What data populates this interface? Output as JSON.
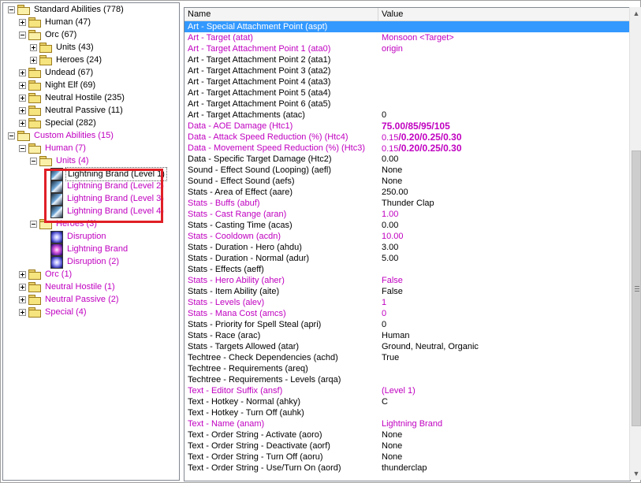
{
  "tree": [
    {
      "label": "Standard Abilities (778)",
      "indent": 0,
      "exp": "minus",
      "icon": "folder-open",
      "magenta": false
    },
    {
      "label": "Human (47)",
      "indent": 1,
      "exp": "plus",
      "icon": "folder",
      "magenta": false
    },
    {
      "label": "Orc (67)",
      "indent": 1,
      "exp": "minus",
      "icon": "folder-open",
      "magenta": false
    },
    {
      "label": "Units (43)",
      "indent": 2,
      "exp": "plus",
      "icon": "folder",
      "magenta": false
    },
    {
      "label": "Heroes (24)",
      "indent": 2,
      "exp": "plus",
      "icon": "folder",
      "magenta": false
    },
    {
      "label": "Undead (67)",
      "indent": 1,
      "exp": "plus",
      "icon": "folder",
      "magenta": false
    },
    {
      "label": "Night Elf (69)",
      "indent": 1,
      "exp": "plus",
      "icon": "folder",
      "magenta": false
    },
    {
      "label": "Neutral Hostile (235)",
      "indent": 1,
      "exp": "plus",
      "icon": "folder",
      "magenta": false
    },
    {
      "label": "Neutral Passive (11)",
      "indent": 1,
      "exp": "plus",
      "icon": "folder",
      "magenta": false
    },
    {
      "label": "Special (282)",
      "indent": 1,
      "exp": "plus",
      "icon": "folder",
      "magenta": false
    },
    {
      "label": "Custom Abilities (15)",
      "indent": 0,
      "exp": "minus",
      "icon": "folder-open",
      "magenta": true
    },
    {
      "label": "Human (7)",
      "indent": 1,
      "exp": "minus",
      "icon": "folder-open",
      "magenta": true
    },
    {
      "label": "Units (4)",
      "indent": 2,
      "exp": "minus",
      "icon": "folder-open",
      "magenta": true
    },
    {
      "label": "Lightning Brand (Level 1)",
      "indent": 3,
      "exp": "",
      "icon": "lb",
      "magenta": false,
      "selected": true
    },
    {
      "label": "Lightning Brand (Level 2)",
      "indent": 3,
      "exp": "",
      "icon": "lb",
      "magenta": true
    },
    {
      "label": "Lightning Brand (Level 3)",
      "indent": 3,
      "exp": "",
      "icon": "lb",
      "magenta": true
    },
    {
      "label": "Lightning Brand (Level 4)",
      "indent": 3,
      "exp": "",
      "icon": "lb",
      "magenta": true
    },
    {
      "label": "Heroes (3)",
      "indent": 2,
      "exp": "minus",
      "icon": "folder-open",
      "magenta": true
    },
    {
      "label": "Disruption",
      "indent": 3,
      "exp": "",
      "icon": "dis",
      "magenta": true
    },
    {
      "label": "Lightning Brand",
      "indent": 3,
      "exp": "",
      "icon": "lbh",
      "magenta": true
    },
    {
      "label": "Disruption (2)",
      "indent": 3,
      "exp": "",
      "icon": "dis",
      "magenta": true
    },
    {
      "label": "Orc (1)",
      "indent": 1,
      "exp": "plus",
      "icon": "folder",
      "magenta": true
    },
    {
      "label": "Neutral Hostile (1)",
      "indent": 1,
      "exp": "plus",
      "icon": "folder",
      "magenta": true
    },
    {
      "label": "Neutral Passive (2)",
      "indent": 1,
      "exp": "plus",
      "icon": "folder",
      "magenta": true
    },
    {
      "label": "Special (4)",
      "indent": 1,
      "exp": "plus",
      "icon": "folder",
      "magenta": true
    }
  ],
  "grid": {
    "col_name": "Name",
    "col_value": "Value",
    "rows": [
      {
        "name": "Art - Special Attachment Point (aspt)",
        "value": "",
        "magenta": false,
        "selected": true
      },
      {
        "name": "Art - Target (atat)",
        "value": "Monsoon <Target>",
        "magenta": true
      },
      {
        "name": "Art - Target Attachment Point 1 (ata0)",
        "value": "origin",
        "magenta": true
      },
      {
        "name": "Art - Target Attachment Point 2 (ata1)",
        "value": "",
        "magenta": false
      },
      {
        "name": "Art - Target Attachment Point 3 (ata2)",
        "value": "",
        "magenta": false
      },
      {
        "name": "Art - Target Attachment Point 4 (ata3)",
        "value": "",
        "magenta": false
      },
      {
        "name": "Art - Target Attachment Point 5 (ata4)",
        "value": "",
        "magenta": false
      },
      {
        "name": "Art - Target Attachment Point 6 (ata5)",
        "value": "",
        "magenta": false
      },
      {
        "name": "Art - Target Attachments (atac)",
        "value": "0",
        "magenta": false
      },
      {
        "name": "Data - AOE Damage (Htc1)",
        "value": "75.00/85/95/105",
        "magenta": true,
        "big": true
      },
      {
        "name": "Data - Attack Speed Reduction (%) (Htc4)",
        "value": "0.15",
        "extra": "/0.20/0.25/0.30",
        "magenta": true
      },
      {
        "name": "Data - Movement Speed Reduction (%) (Htc3)",
        "value": "0.15",
        "extra": "/0.20/0.25/0.30",
        "magenta": true
      },
      {
        "name": "Data - Specific Target Damage (Htc2)",
        "value": "0.00",
        "magenta": false
      },
      {
        "name": "Sound - Effect Sound (Looping) (aefl)",
        "value": "None",
        "magenta": false
      },
      {
        "name": "Sound - Effect Sound (aefs)",
        "value": "None",
        "magenta": false
      },
      {
        "name": "Stats - Area of Effect (aare)",
        "value": "250.00",
        "magenta": false
      },
      {
        "name": "Stats - Buffs (abuf)",
        "value": "Thunder Clap",
        "magenta": true,
        "value_black": true
      },
      {
        "name": "Stats - Cast Range (aran)",
        "value": "1.00",
        "magenta": true
      },
      {
        "name": "Stats - Casting Time (acas)",
        "value": "0.00",
        "magenta": false
      },
      {
        "name": "Stats - Cooldown (acdn)",
        "value": "10.00",
        "magenta": true
      },
      {
        "name": "Stats - Duration - Hero (ahdu)",
        "value": "3.00",
        "magenta": false
      },
      {
        "name": "Stats - Duration - Normal (adur)",
        "value": "5.00",
        "magenta": false
      },
      {
        "name": "Stats - Effects (aeff)",
        "value": "",
        "magenta": false
      },
      {
        "name": "Stats - Hero Ability (aher)",
        "value": "False",
        "magenta": true
      },
      {
        "name": "Stats - Item Ability (aite)",
        "value": "False",
        "magenta": false
      },
      {
        "name": "Stats - Levels (alev)",
        "value": "1",
        "magenta": true
      },
      {
        "name": "Stats - Mana Cost (amcs)",
        "value": "0",
        "magenta": true
      },
      {
        "name": "Stats - Priority for Spell Steal (apri)",
        "value": "0",
        "magenta": false
      },
      {
        "name": "Stats - Race (arac)",
        "value": "Human",
        "magenta": false
      },
      {
        "name": "Stats - Targets Allowed (atar)",
        "value": "Ground, Neutral, Organic",
        "magenta": false
      },
      {
        "name": "Techtree - Check Dependencies (achd)",
        "value": "True",
        "magenta": false
      },
      {
        "name": "Techtree - Requirements (areq)",
        "value": "",
        "magenta": false
      },
      {
        "name": "Techtree - Requirements - Levels (arqa)",
        "value": "",
        "magenta": false
      },
      {
        "name": "Text - Editor Suffix (ansf)",
        "value": " (Level 1)",
        "magenta": true
      },
      {
        "name": "Text - Hotkey - Normal (ahky)",
        "value": "C",
        "magenta": false
      },
      {
        "name": "Text - Hotkey - Turn Off (auhk)",
        "value": "",
        "magenta": false
      },
      {
        "name": "Text - Name (anam)",
        "value": "Lightning Brand",
        "magenta": true
      },
      {
        "name": "Text - Order String - Activate (aoro)",
        "value": "None",
        "magenta": false
      },
      {
        "name": "Text - Order String - Deactivate (aorf)",
        "value": "None",
        "magenta": false
      },
      {
        "name": "Text - Order String - Turn Off (aoru)",
        "value": "None",
        "magenta": false
      },
      {
        "name": "Text - Order String - Use/Turn On (aord)",
        "value": "thunderclap",
        "magenta": false
      }
    ]
  },
  "scrollbar": {
    "up_icon": "arrow-up-icon",
    "down_icon": "arrow-down-icon"
  },
  "colors": {
    "magenta": "#c000c0",
    "selection": "#3399ff",
    "highlight_box": "#e01f26"
  }
}
